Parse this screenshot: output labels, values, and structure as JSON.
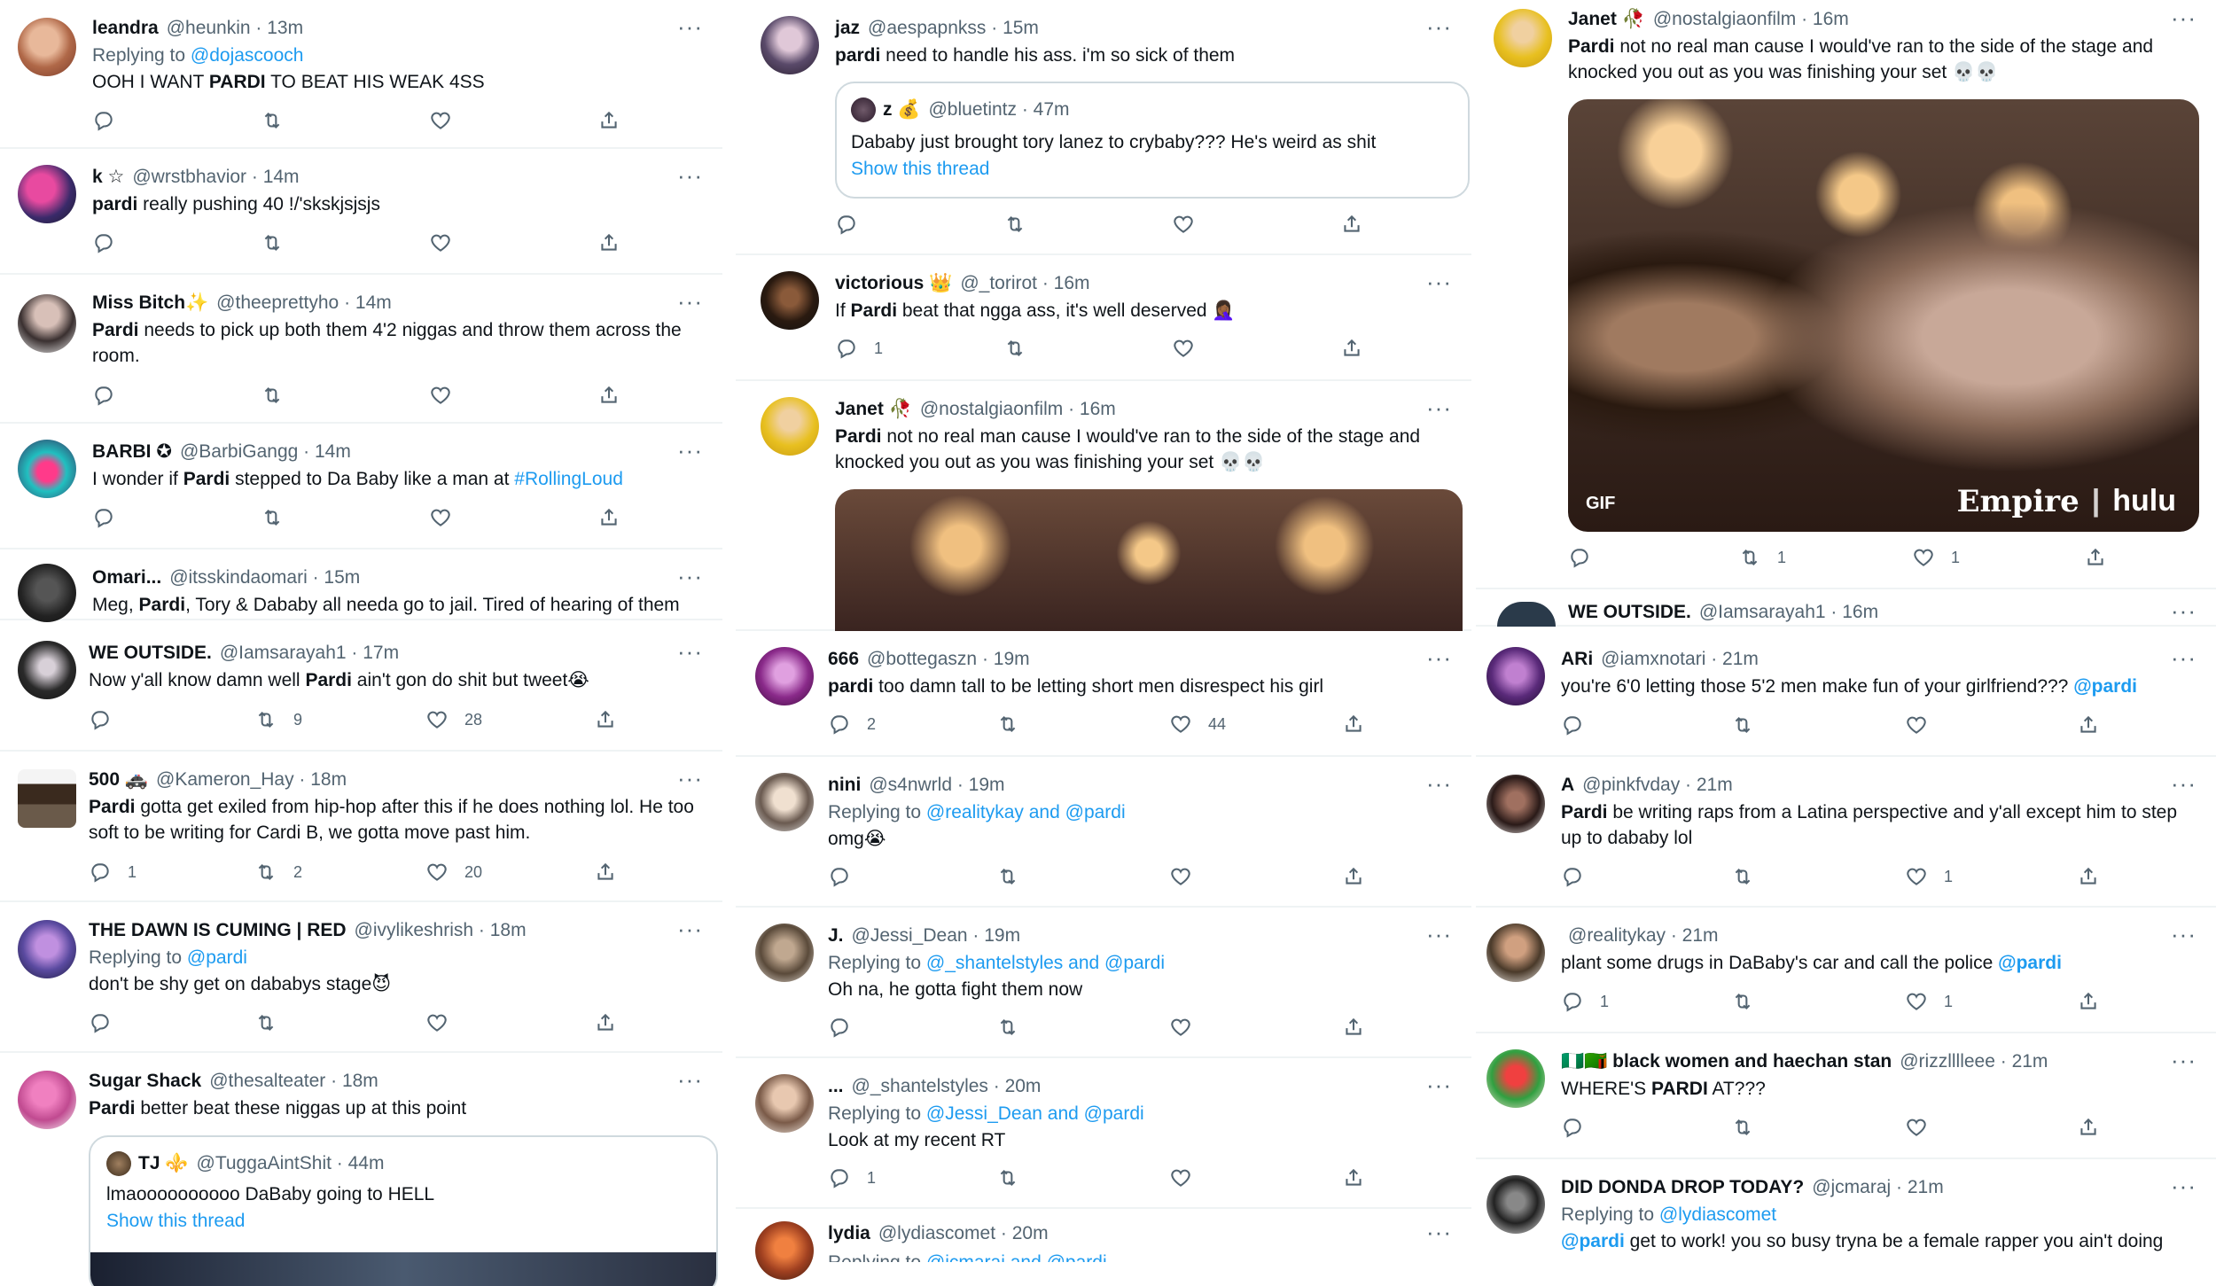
{
  "col1": {
    "t1": {
      "name": "leandra",
      "meta": "@heunkin · 13m",
      "replying": "Replying to",
      "mentions": "@dojascooch",
      "text_a": "OOH I WANT ",
      "text_b": "PARDI",
      "text_c": " TO BEAT HIS WEAK 4SS"
    },
    "t2": {
      "name": "k ☆",
      "meta": "@wrstbhavior · 14m",
      "text_b": "pardi",
      "text_c": " really pushing 40 !/'skskjsjsjs"
    },
    "t3": {
      "name": "Miss Bitch✨",
      "meta": "@theeprettyho · 14m",
      "text_b": "Pardi",
      "text_c": " needs to pick up both them 4'2 niggas and throw them across the room."
    },
    "t4": {
      "name": "BARBI ✪",
      "meta": "@BarbiGangg · 14m",
      "text_a": "I wonder if ",
      "text_b": "Pardi",
      "text_c": " stepped to Da Baby like a man at ",
      "tag": "#RollingLoud"
    },
    "t5": {
      "name": "Omari...",
      "meta": "@itsskindaomari · 15m",
      "text_a": "Meg, ",
      "text_b": "Pardi",
      "text_c": ", Tory & Dababy all needa go to jail. Tired of hearing of them"
    },
    "t6": {
      "name": "WE OUTSIDE.",
      "meta": "@Iamsarayah1 · 17m",
      "text_a": "Now y'all know damn well ",
      "text_b": "Pardi",
      "text_c": " ain't gon do shit but tweet😭",
      "retweets": "9",
      "likes": "28"
    },
    "t7": {
      "name": "500 🚓",
      "meta": "@Kameron_Hay · 18m",
      "text_b": "Pardi",
      "text_c": " gotta get exiled from hip-hop after this if he does nothing lol. He too soft to be writing for Cardi B, we gotta move past him.",
      "replies": "1",
      "retweets": "2",
      "likes": "20"
    },
    "t8": {
      "name": "THE DAWN IS CUMING | RED",
      "meta": "@ivylikeshrish · 18m",
      "replying": "Replying to",
      "mentions": "@pardi",
      "text_a": "don't be shy get on dababys stage😈"
    },
    "t9": {
      "name": "Sugar Shack",
      "meta": "@thesalteater · 18m",
      "text_b": "Pardi",
      "text_c": " better beat these niggas up at this point",
      "quote": {
        "name": "TJ ⚜️",
        "meta": "@TuggaAintShit · 44m",
        "text": "lmaoooooooooo DaBaby going to HELL",
        "link": "Show this thread"
      }
    }
  },
  "col2": {
    "t1": {
      "name": "jaz",
      "meta": "@aespapnkss · 15m",
      "text_b": "pardi",
      "text_c": " need to handle his ass. i'm so sick of them",
      "quote": {
        "name": "z 💰",
        "meta": "@bluetintz · 47m",
        "text": "Dababy just brought tory lanez to crybaby??? He's weird as shit",
        "link": "Show this thread"
      }
    },
    "t2": {
      "name": "victorious 👑",
      "meta": "@_torirot · 16m",
      "text_a": "If ",
      "text_b": "Pardi",
      "text_c": " beat that ngga ass, it's well deserved 🤦🏾‍♀️",
      "replies": "1"
    },
    "t3": {
      "name": "Janet 🥀",
      "meta": "@nostalgiaonfilm · 16m",
      "text_b": "Pardi",
      "text_c": " not no real man cause I would've ran to the side of the stage and knocked you out as you was finishing your set 💀💀"
    },
    "t4": {
      "name": "666",
      "meta": "@bottegaszn · 19m",
      "text_b": "pardi",
      "text_c": " too damn tall to be letting short men disrespect his girl",
      "replies": "2",
      "likes": "44"
    },
    "t5": {
      "name": "nini",
      "meta": "@s4nwrld · 19m",
      "replying": "Replying to",
      "mentions": "@realitykay and @pardi",
      "text_a": "omg😭"
    },
    "t6": {
      "name": "J.",
      "meta": "@Jessi_Dean · 19m",
      "replying": "Replying to",
      "mentions": "@_shantelstyles and @pardi",
      "text_a": "Oh na, he gotta fight them now"
    },
    "t7": {
      "name": "...",
      "meta": "@_shantelstyles · 20m",
      "replying": "Replying to",
      "mentions": "@Jessi_Dean and @pardi",
      "text_a": "Look at my recent RT",
      "replies": "1"
    },
    "t8": {
      "name": "lydia",
      "meta": "@lydiascomet · 20m",
      "replying": "Replying to",
      "mentions": "@jcmaraj and @pardi"
    }
  },
  "col3": {
    "t1": {
      "name": "Janet 🥀",
      "meta": "@nostalgiaonfilm · 16m",
      "text_b": "Pardi",
      "text_c": " not no real man cause I would've ran to the side of the stage and knocked you out as you was finishing your set 💀💀",
      "gif_badge": "GIF",
      "wm1": "Empire",
      "wm2": "hulu",
      "retweets": "1",
      "likes": "1"
    },
    "t2": {
      "name": "WE OUTSIDE.",
      "meta": "@Iamsarayah1 · 16m"
    },
    "t3": {
      "name": "ARi",
      "meta": "@iamxnotari · 21m",
      "text_a": "you're 6'0 letting those 5'2 men make fun of your girlfriend??? ",
      "tag": "@pardi"
    },
    "t4": {
      "name": "A",
      "meta": "@pinkfvday · 21m",
      "text_b": "Pardi",
      "text_c": " be writing raps from a Latina perspective and y'all except him to step up to dababy lol",
      "likes": "1"
    },
    "t5": {
      "name": "",
      "meta": "@realitykay · 21m",
      "text_a": "plant some drugs in DaBaby's car and call the police ",
      "tag": "@pardi",
      "replies": "1",
      "likes": "1"
    },
    "t6": {
      "name": "🇳🇬🇿🇲 black women and haechan stan",
      "meta": "@rizzlllleee · 21m",
      "text_a": "WHERE'S ",
      "text_b": "PARDI",
      "text_c": " AT???"
    },
    "t7": {
      "name": "DID DONDA DROP TODAY?",
      "meta": "@jcmaraj · 21m",
      "replying": "Replying to",
      "mentions": "@lydiascomet",
      "tag": "@pardi",
      "text_c": " get to work! you so busy tryna be a female rapper you ain't doing"
    }
  },
  "icons": {
    "reply": "reply-icon",
    "retweet": "retweet-icon",
    "like": "heart-icon",
    "share": "share-icon",
    "more": "more-icon"
  },
  "colors": {
    "link": "#1d9bf0",
    "muted": "#536471",
    "text": "#0f1419"
  }
}
